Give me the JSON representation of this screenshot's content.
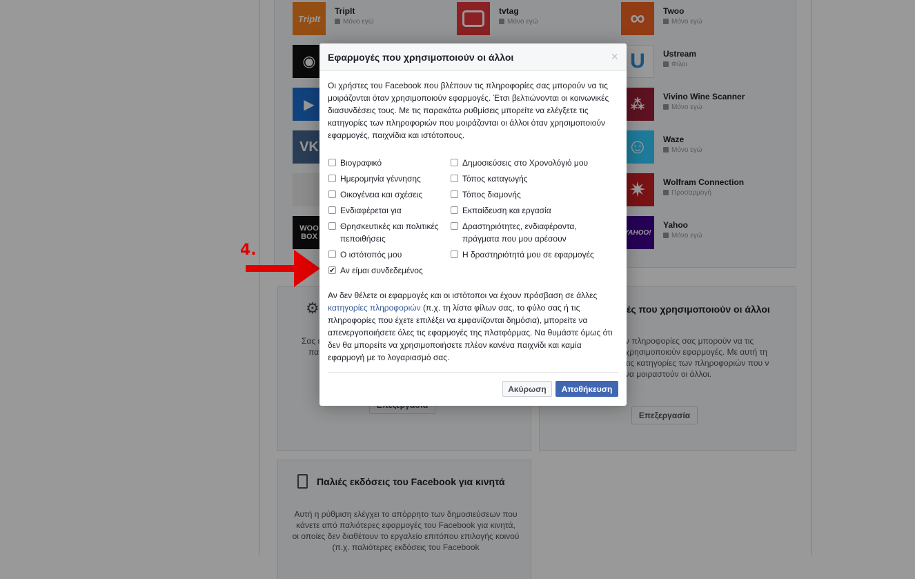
{
  "apps": [
    {
      "name": "TripIt",
      "privacy": "Μόνο εγώ",
      "logo_text": "TripIt",
      "color": "#f58220"
    },
    {
      "name": "tvtag",
      "privacy": "Μόνο εγώ",
      "logo_text": "",
      "color": "#e8383d"
    },
    {
      "name": "Twoo",
      "privacy": "Μόνο εγώ",
      "logo_text": "∞",
      "color": "#f26522"
    },
    {
      "name": "Ustream",
      "privacy": "Φίλοι",
      "logo_text": "U",
      "color": "#2d8ed8"
    },
    {
      "name": "Vivino Wine Scanner",
      "privacy": "Μόνο εγώ",
      "logo_text": "",
      "color": "#9a1e36"
    },
    {
      "name": "Waze",
      "privacy": "Μόνο εγώ",
      "logo_text": "☺",
      "color": "#33ccff"
    },
    {
      "name": "Wolfram Connection",
      "privacy": "Προσαρμογή",
      "logo_text": "✷",
      "color": "#c81e24"
    },
    {
      "name": "Yahoo",
      "privacy": "Μόνο εγώ",
      "logo_text": "YAHOO!",
      "color": "#400090"
    }
  ],
  "left_logos": [
    {
      "text": "◉",
      "color": "#111111"
    },
    {
      "text": "▶",
      "color": "#1f6fd1"
    },
    {
      "text": "VK",
      "color": "#45668e"
    },
    {
      "text": "",
      "color": "#e9e9e9"
    },
    {
      "text": "WOO BOX",
      "color": "#111111"
    }
  ],
  "panels": {
    "right": {
      "title": "ές που χρησιμοποιούν οι άλλοι",
      "text": "ν πληροφορίες σας μπορούν να τις χρησιμοποιούν εφαρμογές. Με αυτή τη τις κατηγορίες των πληροφοριών που ν να μοιραστούν οι άλλοι.",
      "edit": "Επεξεργασία"
    },
    "left": {
      "text1": "Σας ε",
      "text2": "πα",
      "edit": "Επεξεργασία"
    },
    "mobile": {
      "title": "Παλιές εκδόσεις του Facebook για κινητά",
      "text": "Αυτή η ρύθμιση ελέγχει το απόρρητο των δημοσιεύσεων που κάνετε από παλιότερες εφαρμογές του Facebook για κινητά, οι οποίες δεν διαθέτουν το εργαλείο επιτόπου επιλογής κοινού (π.χ. παλιότερες εκδόσεις του Facebook"
    }
  },
  "annotation": {
    "label": "4."
  },
  "dialog": {
    "title": "Εφαρμογές που χρησιμοποιούν οι άλλοι",
    "close": "×",
    "intro": "Οι χρήστες του Facebook που βλέπουν τις πληροφορίες σας μπορούν να τις μοιράζονται όταν χρησιμοποιούν εφαρμογές. Έτσι βελτιώνονται οι κοινωνικές διασυνδέσεις τους. Με τις παρακάτω ρυθμίσεις μπορείτε να ελέγξετε τις κατηγορίες των πληροφοριών που μοιράζονται οι άλλοι όταν χρησιμοποιούν εφαρμογές, παιχνίδια και ιστότοπους.",
    "checkboxes_left": [
      {
        "label": "Βιογραφικό",
        "checked": false
      },
      {
        "label": "Ημερομηνία γέννησης",
        "checked": false
      },
      {
        "label": "Οικογένεια και σχέσεις",
        "checked": false
      },
      {
        "label": "Ενδιαφέρεται για",
        "checked": false
      },
      {
        "label": "Θρησκευτικές και πολιτικές πεποιθήσεις",
        "checked": false
      },
      {
        "label": "Ο ιστότοπός μου",
        "checked": false
      },
      {
        "label": "Αν είμαι συνδεδεμένος",
        "checked": true
      }
    ],
    "checkboxes_right": [
      {
        "label": "Δημοσιεύσεις στο Χρονολόγιό μου",
        "checked": false
      },
      {
        "label": "Τόπος καταγωγής",
        "checked": false
      },
      {
        "label": "Τόπος διαμονής",
        "checked": false
      },
      {
        "label": "Εκπαίδευση και εργασία",
        "checked": false
      },
      {
        "label": "Δραστηριότητες, ενδιαφέροντα, πράγματα που μου αρέσουν",
        "checked": false
      },
      {
        "label": "Η δραστηριότητά μου σε εφαρμογές",
        "checked": false
      }
    ],
    "note_before": "Αν δεν θέλετε οι εφαρμογές και οι ιστότοποι να έχουν πρόσβαση σε άλλες ",
    "note_link": "κατηγορίες πληροφοριών",
    "note_after": " (π.χ. τη λίστα φίλων σας, το φύλο σας ή τις πληροφορίες που έχετε επιλέξει να εμφανίζονται δημόσια), μπορείτε να απενεργοποιήσετε όλες τις εφαρμογές της πλατφόρμας. Να θυμάστε όμως ότι δεν θα μπορείτε να χρησιμοποιήσετε πλέον κανένα παιχνίδι και καμία εφαρμογή με το λογαριασμό σας.",
    "cancel": "Ακύρωση",
    "save": "Αποθήκευση"
  }
}
